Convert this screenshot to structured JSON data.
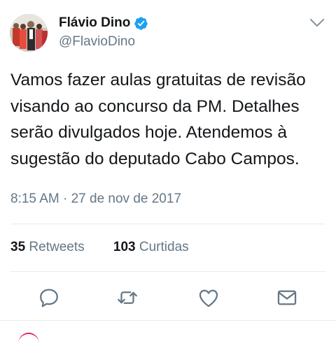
{
  "tweet": {
    "author_name": "Flávio Dino",
    "handle": "@FlavioDino",
    "text": "Vamos fazer aulas gratuitas de revisão\nvisando ao concurso da PM. Detalhes\nserão divulgados hoje. Atendemos à\nsugestão do deputado Cabo Campos.",
    "timestamp": "8:15 AM · 27 de nov de 2017",
    "retweets_count": "35",
    "retweets_label": "Retweets",
    "likes_count": "103",
    "likes_label": "Curtidas"
  },
  "icons": {
    "verified": "verified-badge-icon",
    "menu": "chevron-down-icon",
    "reply": "reply-icon",
    "retweet": "retweet-icon",
    "like": "heart-icon",
    "share": "envelope-icon"
  },
  "colors": {
    "verified_blue": "#1da1f2",
    "secondary_text": "#657786",
    "icon_gray": "#657786",
    "divider": "#e6ecf0"
  }
}
